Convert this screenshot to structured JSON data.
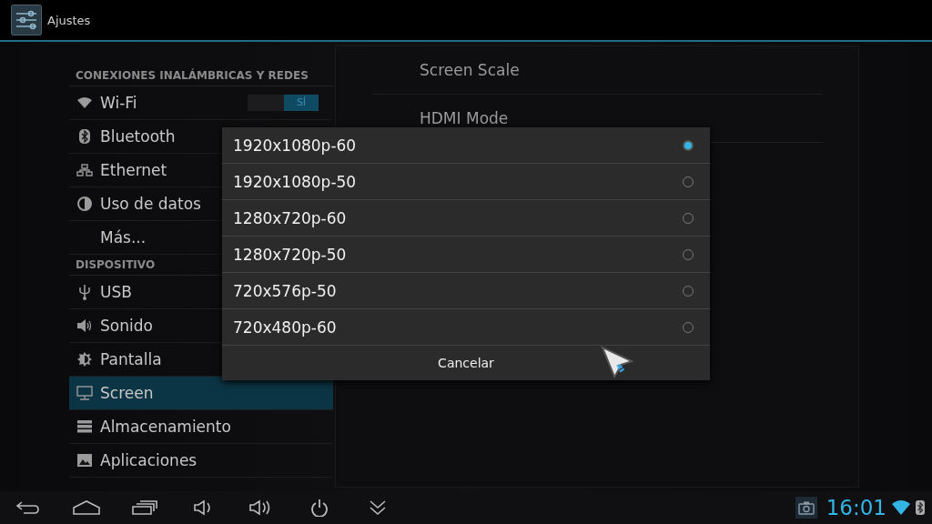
{
  "app_bar": {
    "title": "Ajustes"
  },
  "sidebar": {
    "sections": [
      {
        "header": "CONEXIONES INALÁMBRICAS Y REDES",
        "items": [
          {
            "label": "Wi-Fi",
            "selected": false,
            "toggle": {
              "label": "SÍ",
              "on": true
            }
          },
          {
            "label": "Bluetooth",
            "selected": false
          },
          {
            "label": "Ethernet",
            "selected": false
          },
          {
            "label": "Uso de datos",
            "selected": false
          },
          {
            "label": "Más...",
            "selected": false
          }
        ]
      },
      {
        "header": "DISPOSITIVO",
        "items": [
          {
            "label": "USB",
            "selected": false
          },
          {
            "label": "Sonido",
            "selected": false
          },
          {
            "label": "Pantalla",
            "selected": false
          },
          {
            "label": "Screen",
            "selected": true
          },
          {
            "label": "Almacenamiento",
            "selected": false
          },
          {
            "label": "Aplicaciones",
            "selected": false
          }
        ]
      }
    ]
  },
  "detail": {
    "items": [
      {
        "title": "Screen Scale"
      },
      {
        "title": "HDMI Mode"
      }
    ]
  },
  "dialog": {
    "options": [
      {
        "label": "1920x1080p-60",
        "selected": true
      },
      {
        "label": "1920x1080p-50",
        "selected": false
      },
      {
        "label": "1280x720p-60",
        "selected": false
      },
      {
        "label": "1280x720p-50",
        "selected": false
      },
      {
        "label": "720x576p-50",
        "selected": false
      },
      {
        "label": "720x480p-60",
        "selected": false
      }
    ],
    "cancel": "Cancelar"
  },
  "nav_bar": {
    "time": "16:01"
  }
}
